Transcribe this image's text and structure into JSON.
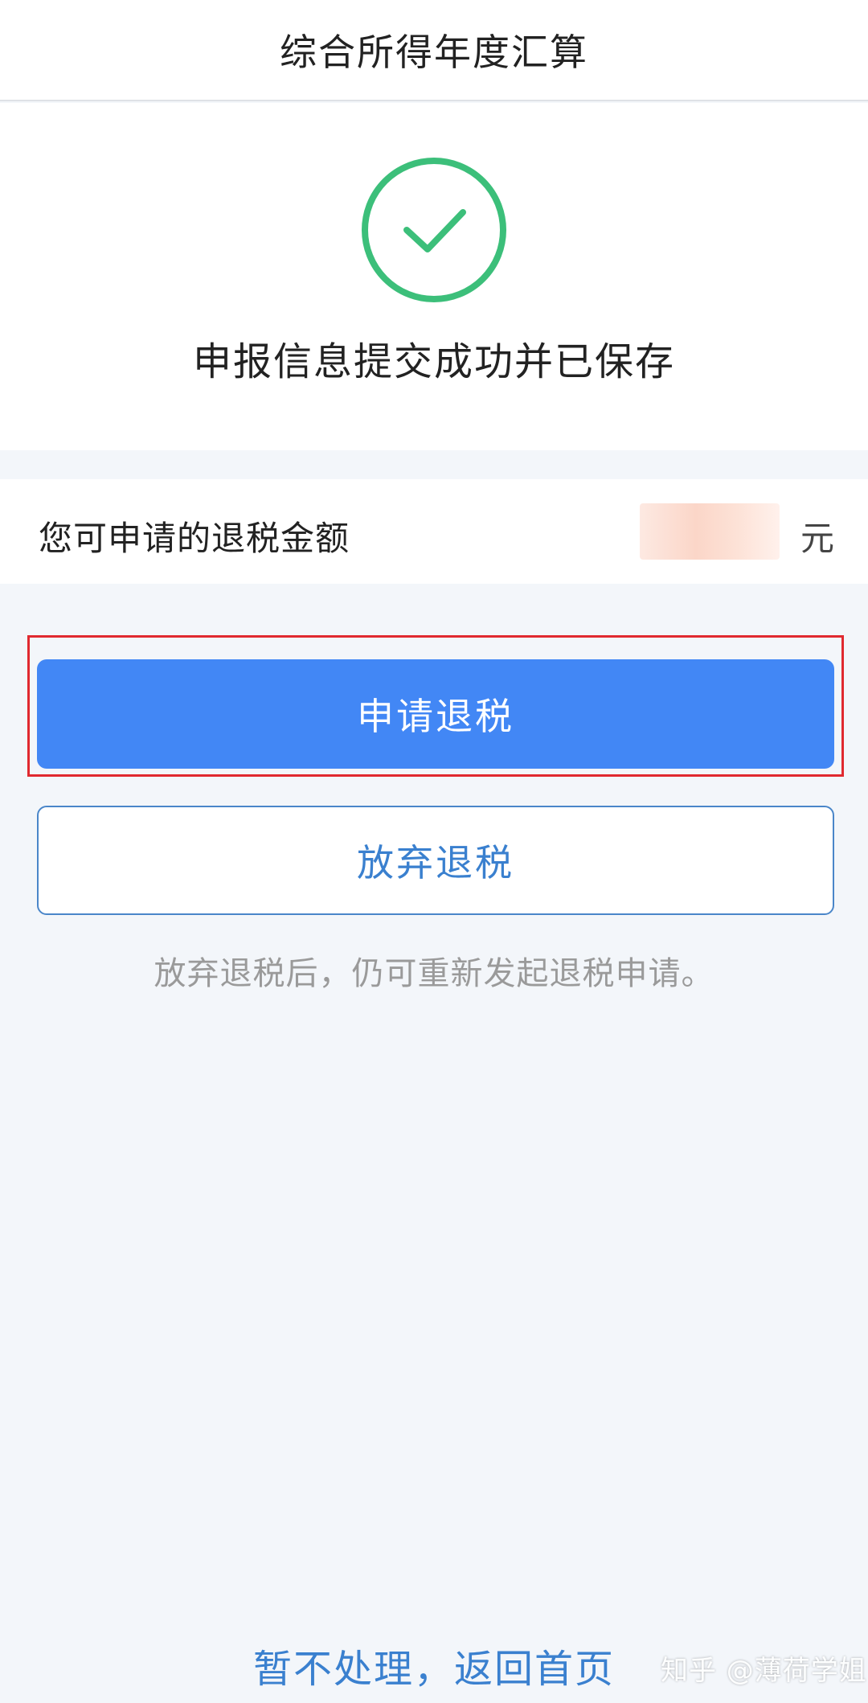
{
  "header": {
    "title": "综合所得年度汇算"
  },
  "success": {
    "icon": "check-circle-icon",
    "message": "申报信息提交成功并已保存",
    "icon_color": "#3cbf7a"
  },
  "refund": {
    "label": "您可申请的退税金额",
    "unit": "元"
  },
  "actions": {
    "apply_label": "申请退税",
    "abandon_label": "放弃退税",
    "hint": "放弃退税后，仍可重新发起退税申请。",
    "primary_color": "#4287f5",
    "highlight_color": "#e0292f"
  },
  "footer": {
    "link_label": "暂不处理，返回首页"
  },
  "watermark": {
    "text": "知乎 @薄荷学姐"
  }
}
